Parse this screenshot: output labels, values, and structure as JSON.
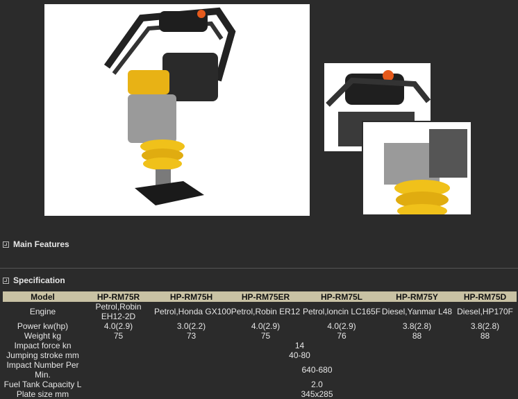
{
  "sections": {
    "features_title": "Main Features",
    "spec_title": "Specification"
  },
  "table": {
    "headers": [
      "Model",
      "HP-RM75R",
      "HP-RM75H",
      "HP-RM75ER",
      "HP-RM75L",
      "HP-RM75Y",
      "HP-RM75D"
    ],
    "engine_label": "Engine",
    "engine": [
      "Petrol,Robin EH12-2D",
      "Petrol,Honda GX100",
      "Petrol,Robin ER12",
      "Petrol,loncin LC165F",
      "Diesel,Yanmar L48",
      "Diesel,HP170F"
    ],
    "power_label": "Power kw(hp)",
    "power": [
      "4.0(2.9)",
      "3.0(2.2)",
      "4.0(2.9)",
      "4.0(2.9)",
      "3.8(2.8)",
      "3.8(2.8)"
    ],
    "weight_label": "Weight kg",
    "weight": [
      "75",
      "73",
      "75",
      "76",
      "88",
      "88"
    ],
    "impact_force_label": "Impact force kn",
    "impact_force": "14",
    "jumping_stroke_label": "Jumping stroke mm",
    "jumping_stroke": "40-80",
    "impact_number_label": "Impact Number Per Min.",
    "impact_number": "640-680",
    "fuel_tank_label": "Fuel Tank Capacity L",
    "fuel_tank": "2.0",
    "plate_size_label": "Plate size mm",
    "plate_size": "345x285"
  }
}
